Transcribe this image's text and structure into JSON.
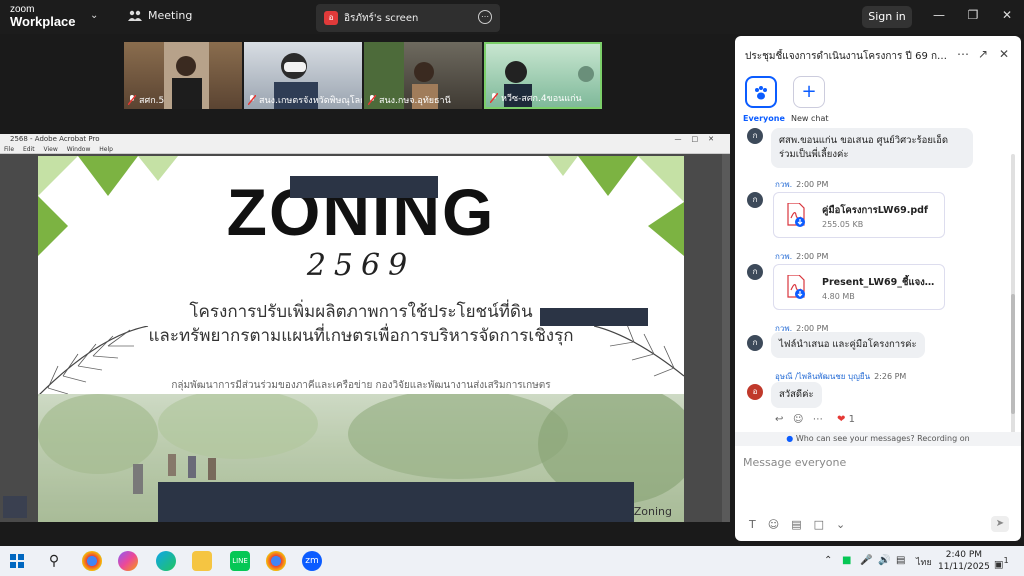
{
  "app": {
    "logo_line1": "zoom",
    "logo_line2": "Workplace",
    "meeting_tab": "Meeting",
    "share_tab": "อิรภัทร์'s screen",
    "share_tab_initial": "อ",
    "signin": "Sign in"
  },
  "participants": [
    {
      "name": "สศก.5"
    },
    {
      "name": "สนง.เกษตรจังหวัดพิษณุโลก"
    },
    {
      "name": "สนง.กษจ.อุทัยธานี"
    },
    {
      "name": "หวีซ-สศก.4ขอนแก่น"
    }
  ],
  "acrobat": {
    "title": "2568 - Adobe Acrobat Pro",
    "menu": [
      "File",
      "Edit",
      "View",
      "Window",
      "Help"
    ]
  },
  "slide": {
    "title": "ZONING",
    "year": "2569",
    "line1": "โครงการปรับเพิ่มผลิตภาพการใช้ประโยชน์ที่ดิน",
    "line2": "และทรัพยากรตามแผนที่เกษตรเพื่อการบริหารจัดการเชิงรุก",
    "line3": "กลุ่มพัฒนาการมีส่วนร่วมของภาคีและเครือข่าย กองวิจัยและพัฒนางานส่งเสริมการเกษตร",
    "footer": "e Zoning"
  },
  "chat": {
    "title": "ประชุมชี้แจงการดำเนินงานโครงการ ปี 69 กองวิ...",
    "tab_everyone": "Everyone",
    "tab_new_chat": "New chat",
    "messages": {
      "m1_text_1": "ศสพ.ขอนแก่น ขอเสนอ ศูนย์วิศวะร้อยเอ็ด",
      "m1_text_2": "ร่วมเป็นพี่เลี้ยงค่ะ",
      "m2_sender": "กวพ.",
      "m2_time": "2:00 PM",
      "m2_file": "คู่มือโครงการLW69.pdf",
      "m2_size": "255.05 KB",
      "m3_sender": "กวพ.",
      "m3_time": "2:00 PM",
      "m3_file": "Present_LW69_ชี้แจงโ...",
      "m3_size": "4.80 MB",
      "m4_sender": "กวพ.",
      "m4_time": "2:00 PM",
      "m4_text": "ไฟล์นำเสนอ และคู่มือโครงการค่ะ",
      "m5_sender": "อุษณี /ไพลินพัฒนชย บุญยืน",
      "m5_time": "2:26 PM",
      "m5_text": "สวัสดีค่ะ",
      "m5_reaction_count": "1",
      "avatar_initial": "ก",
      "avatar_initial_red": "อ"
    },
    "privacy": "Who can see your messages? Recording on",
    "input_placeholder": "Message everyone"
  },
  "taskbar": {
    "lang": "ไทย",
    "time": "2:40 PM",
    "date": "11/11/2025",
    "notif": "1",
    "zoom_icon_label": "zm"
  },
  "colors": {
    "accent": "#0b5cff",
    "slide_green": "#7cb342",
    "slide_light_green": "#c5e1a5"
  }
}
